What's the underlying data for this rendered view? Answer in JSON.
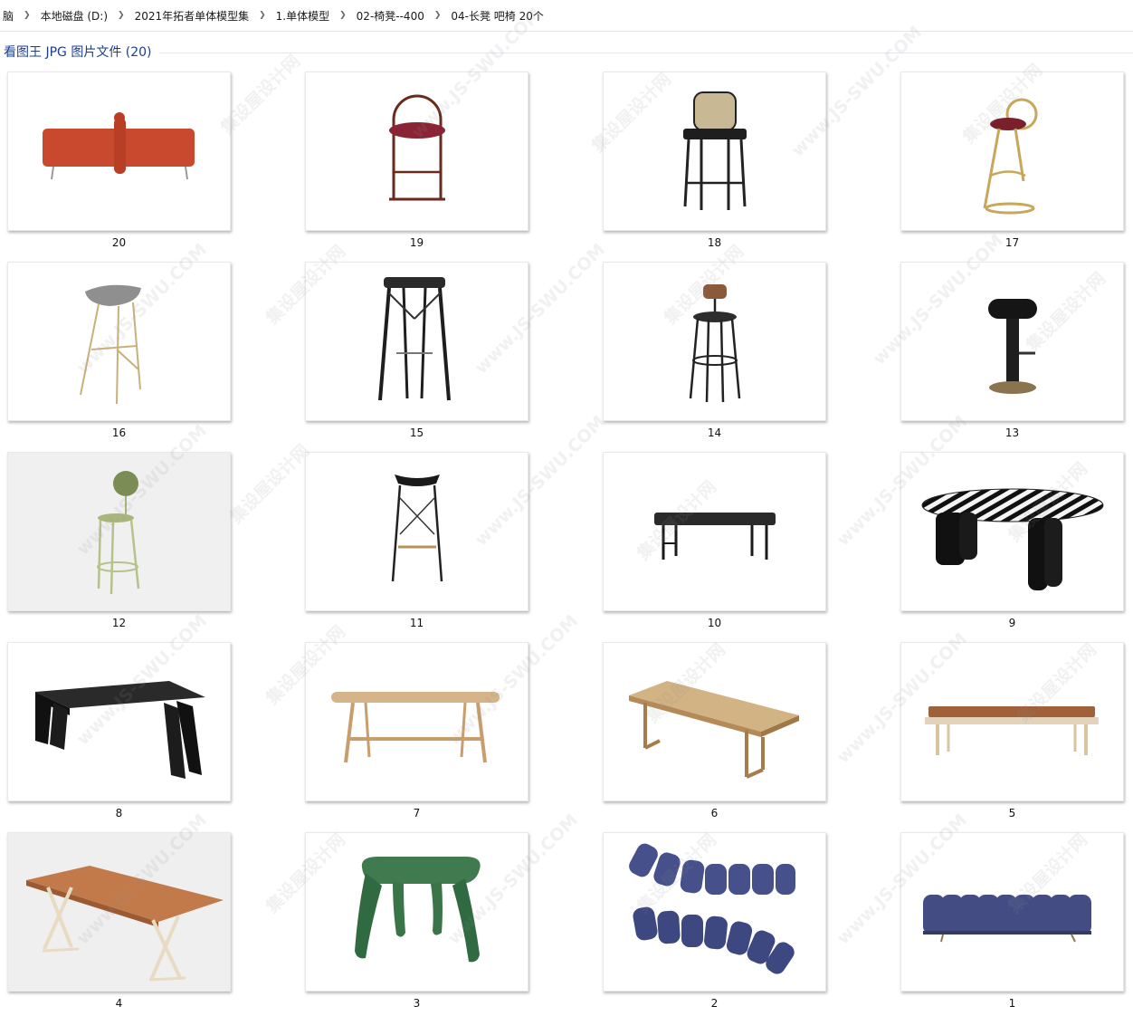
{
  "breadcrumb": [
    "脑",
    "本地磁盘 (D:)",
    "2021年拓者单体模型集",
    "1.单体模型",
    "02-椅凳--400",
    "04-长凳 吧椅 20个"
  ],
  "group": {
    "title": "看图王 JPG 图片文件 (20)"
  },
  "files": [
    {
      "label": "20",
      "icon": "red-ottoman-bench"
    },
    {
      "label": "19",
      "icon": "arched-bar-stool"
    },
    {
      "label": "18",
      "icon": "rattan-back-bar-stool"
    },
    {
      "label": "17",
      "icon": "gold-ring-bar-stool"
    },
    {
      "label": "16",
      "icon": "grey-seat-tripod-stool"
    },
    {
      "label": "15",
      "icon": "black-wood-bar-stool"
    },
    {
      "label": "14",
      "icon": "wood-back-bar-stool"
    },
    {
      "label": "13",
      "icon": "round-base-bar-stool"
    },
    {
      "label": "12",
      "icon": "green-round-back-stool"
    },
    {
      "label": "11",
      "icon": "cross-frame-bar-stool"
    },
    {
      "label": "10",
      "icon": "black-upholstered-bench"
    },
    {
      "label": "9",
      "icon": "striped-top-bench"
    },
    {
      "label": "8",
      "icon": "black-slab-bench"
    },
    {
      "label": "7",
      "icon": "oak-trestle-bench"
    },
    {
      "label": "6",
      "icon": "woven-seat-bench"
    },
    {
      "label": "5",
      "icon": "leather-cushion-bench"
    },
    {
      "label": "4",
      "icon": "leather-sling-bench"
    },
    {
      "label": "3",
      "icon": "green-velvet-stool"
    },
    {
      "label": "2",
      "icon": "navy-tufted-lounger"
    },
    {
      "label": "1",
      "icon": "navy-tufted-bench"
    }
  ],
  "watermark": {
    "text_a": "集设屋设计网",
    "text_b": "www.JS-SWU.COM"
  }
}
